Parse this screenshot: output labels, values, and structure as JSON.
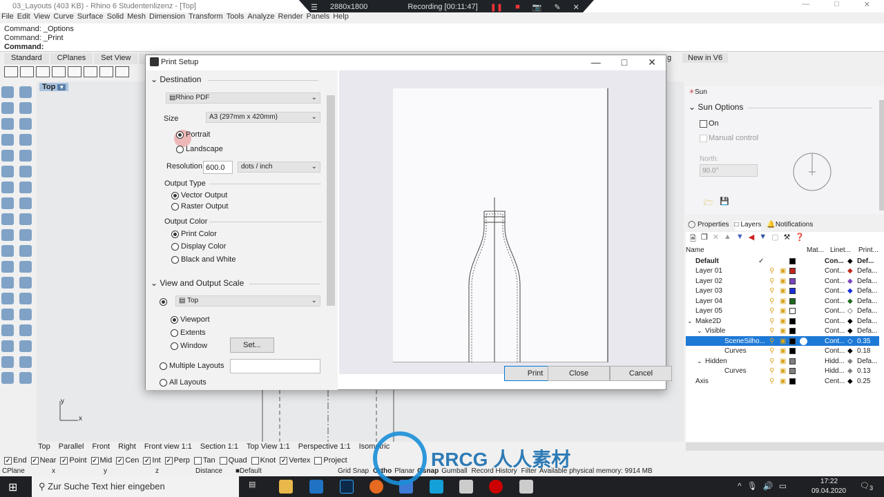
{
  "window": {
    "title": "03_Layouts (403 KB) - Rhino 6 Studentenlizenz - [Top]"
  },
  "recorder": {
    "resolution": "2880x1800",
    "status": "Recording [00:11:47]"
  },
  "menu": [
    "File",
    "Edit",
    "View",
    "Curve",
    "Surface",
    "Solid",
    "Mesh",
    "Dimension",
    "Transform",
    "Tools",
    "Analyze",
    "Render",
    "Panels",
    "Help"
  ],
  "command": {
    "history": [
      "Command: _Options",
      "Command: _Print"
    ],
    "prompt": "Command:"
  },
  "toolbar_tabs": [
    "Standard",
    "CPlanes",
    "Set View",
    "D",
    "g",
    "New in V6"
  ],
  "viewport": {
    "name": "Top",
    "axis_x": "x",
    "axis_y": "y"
  },
  "dialog": {
    "title": "Print Setup",
    "destination": {
      "heading": "Destination",
      "printer": "Rhino PDF",
      "size_label": "Size",
      "size": "A3 (297mm x 420mm)",
      "portrait": "Portrait",
      "landscape": "Landscape",
      "orientation": "Portrait",
      "resolution_label": "Resolution",
      "resolution": "600.0",
      "resolution_unit": "dots / inch"
    },
    "output_type": {
      "heading": "Output Type",
      "options": [
        "Vector Output",
        "Raster Output"
      ],
      "selected": "Vector Output"
    },
    "output_color": {
      "heading": "Output Color",
      "options": [
        "Print Color",
        "Display Color",
        "Black and White"
      ],
      "selected": "Print Color"
    },
    "scale": {
      "heading": "View and Output Scale",
      "view": "Top",
      "options": [
        "Viewport",
        "Extents",
        "Window"
      ],
      "selected": "Viewport",
      "set_label": "Set...",
      "multiple_layouts": "Multiple Layouts",
      "all_layouts": "All Layouts"
    },
    "buttons": {
      "print": "Print",
      "close": "Close",
      "cancel": "Cancel"
    }
  },
  "sun": {
    "tab": "Sun",
    "heading": "Sun Options",
    "on": "On",
    "manual": "Manual control",
    "north_label": "North:",
    "north": "90.0°"
  },
  "layers_panel": {
    "tabs": [
      "Properties",
      "Layers",
      "Notifications"
    ],
    "columns": [
      "Name",
      "Mat...",
      "Linet...",
      "Print..."
    ],
    "rows": [
      {
        "name": "Default",
        "color": "#000000",
        "linetype": "Con...",
        "print": "Def...",
        "bold": true,
        "current": true,
        "indent": 0
      },
      {
        "name": "Layer 01",
        "color": "#c0281e",
        "linetype": "Cont...",
        "print": "Defa...",
        "indent": 0
      },
      {
        "name": "Layer 02",
        "color": "#7a45c0",
        "linetype": "Cont...",
        "print": "Defa...",
        "indent": 0
      },
      {
        "name": "Layer 03",
        "color": "#1a2fd8",
        "linetype": "Cont...",
        "print": "Defa...",
        "indent": 0
      },
      {
        "name": "Layer 04",
        "color": "#1e6a1e",
        "linetype": "Cont...",
        "print": "Defa...",
        "indent": 0
      },
      {
        "name": "Layer 05",
        "color": "#ffffff",
        "linetype": "Cont...",
        "print": "Defa...",
        "indent": 0
      },
      {
        "name": "Make2D",
        "color": "#000000",
        "linetype": "Cont...",
        "print": "Defa...",
        "indent": 0,
        "expanded": true
      },
      {
        "name": "Visible",
        "color": "#000000",
        "linetype": "Cont...",
        "print": "Defa...",
        "indent": 1,
        "expanded": true
      },
      {
        "name": "SceneSilho...",
        "color": "#000000",
        "linetype": "Cont...",
        "print": "0.35",
        "indent": 2,
        "selected": true
      },
      {
        "name": "Curves",
        "color": "#000000",
        "linetype": "Cont...",
        "print": "0.18",
        "indent": 2
      },
      {
        "name": "Hidden",
        "color": "#808080",
        "linetype": "Hidd...",
        "print": "Defa...",
        "indent": 1,
        "expanded": true
      },
      {
        "name": "Curves",
        "color": "#808080",
        "linetype": "Hidd...",
        "print": "0.13",
        "indent": 2
      },
      {
        "name": "Axis",
        "color": "#000000",
        "linetype": "Cent...",
        "print": "0.25",
        "indent": 0
      }
    ]
  },
  "view_tabs": [
    "Top",
    "Parallel",
    "Front",
    "Right",
    "Front view 1:1",
    "Section 1:1",
    "Top View 1:1",
    "Perspective 1:1",
    "Isometric"
  ],
  "osnaps": [
    {
      "label": "End",
      "on": true
    },
    {
      "label": "Near",
      "on": true
    },
    {
      "label": "Point",
      "on": true
    },
    {
      "label": "Mid",
      "on": true
    },
    {
      "label": "Cen",
      "on": true
    },
    {
      "label": "Int",
      "on": true
    },
    {
      "label": "Perp",
      "on": true
    },
    {
      "label": "Tan",
      "on": false
    },
    {
      "label": "Quad",
      "on": false
    },
    {
      "label": "Knot",
      "on": false
    },
    {
      "label": "Vertex",
      "on": true
    },
    {
      "label": "Project",
      "on": false
    }
  ],
  "statusbar": {
    "cplane": "CPlane",
    "x": "x",
    "y": "y",
    "z": "z",
    "distance": "Distance",
    "layer": "Default",
    "grid_snap": "Grid Snap",
    "ortho": "Ortho",
    "planar": "Planar",
    "osnap": "Osnap",
    "gumball": "Gumball",
    "record_history": "Record History",
    "filter": "Filter",
    "memory": "Available physical memory: 9914 MB"
  },
  "taskbar": {
    "search_placeholder": "Zur Suche Text hier eingeben",
    "time": "17:22",
    "date": "09.04.2020",
    "notifications": "3"
  },
  "watermark": "RRCG 人人素材"
}
